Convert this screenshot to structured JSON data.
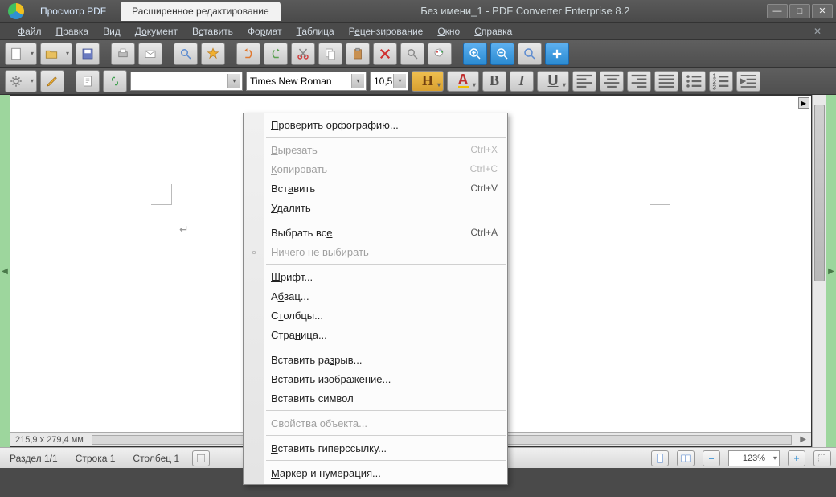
{
  "titlebar": {
    "tab_view": "Просмотр PDF",
    "tab_edit": "Расширенное редактирование",
    "title": "Без имени_1 - PDF Converter Enterprise 8.2"
  },
  "menu": {
    "file": "Файл",
    "edit": "Правка",
    "view": "Вид",
    "document": "Документ",
    "insert": "Вставить",
    "format": "Формат",
    "table": "Таблица",
    "review": "Рецензирование",
    "window": "Окно",
    "help": "Справка"
  },
  "format": {
    "style_combo": "",
    "font": "Times New Roman",
    "size": "10,5"
  },
  "ruler_info": "215,9 x 279,4 мм",
  "status": {
    "section": "Раздел 1/1",
    "line": "Строка 1",
    "column": "Столбец 1",
    "zoom": "123%"
  },
  "context_menu": {
    "spellcheck": "Проверить орфографию...",
    "cut": "Вырезать",
    "cut_sc": "Ctrl+X",
    "copy": "Копировать",
    "copy_sc": "Ctrl+C",
    "paste": "Вставить",
    "paste_sc": "Ctrl+V",
    "delete": "Удалить",
    "select_all": "Выбрать все",
    "select_all_sc": "Ctrl+A",
    "select_none": "Ничего не выбирать",
    "font": "Шрифт...",
    "paragraph": "Абзац...",
    "columns": "Столбцы...",
    "page": "Страница...",
    "insert_break": "Вставить разрыв...",
    "insert_image": "Вставить изображение...",
    "insert_symbol": "Вставить символ",
    "object_props": "Свойства объекта...",
    "insert_hyperlink": "Вставить гиперссылку...",
    "bullets": "Маркер и нумерация..."
  }
}
